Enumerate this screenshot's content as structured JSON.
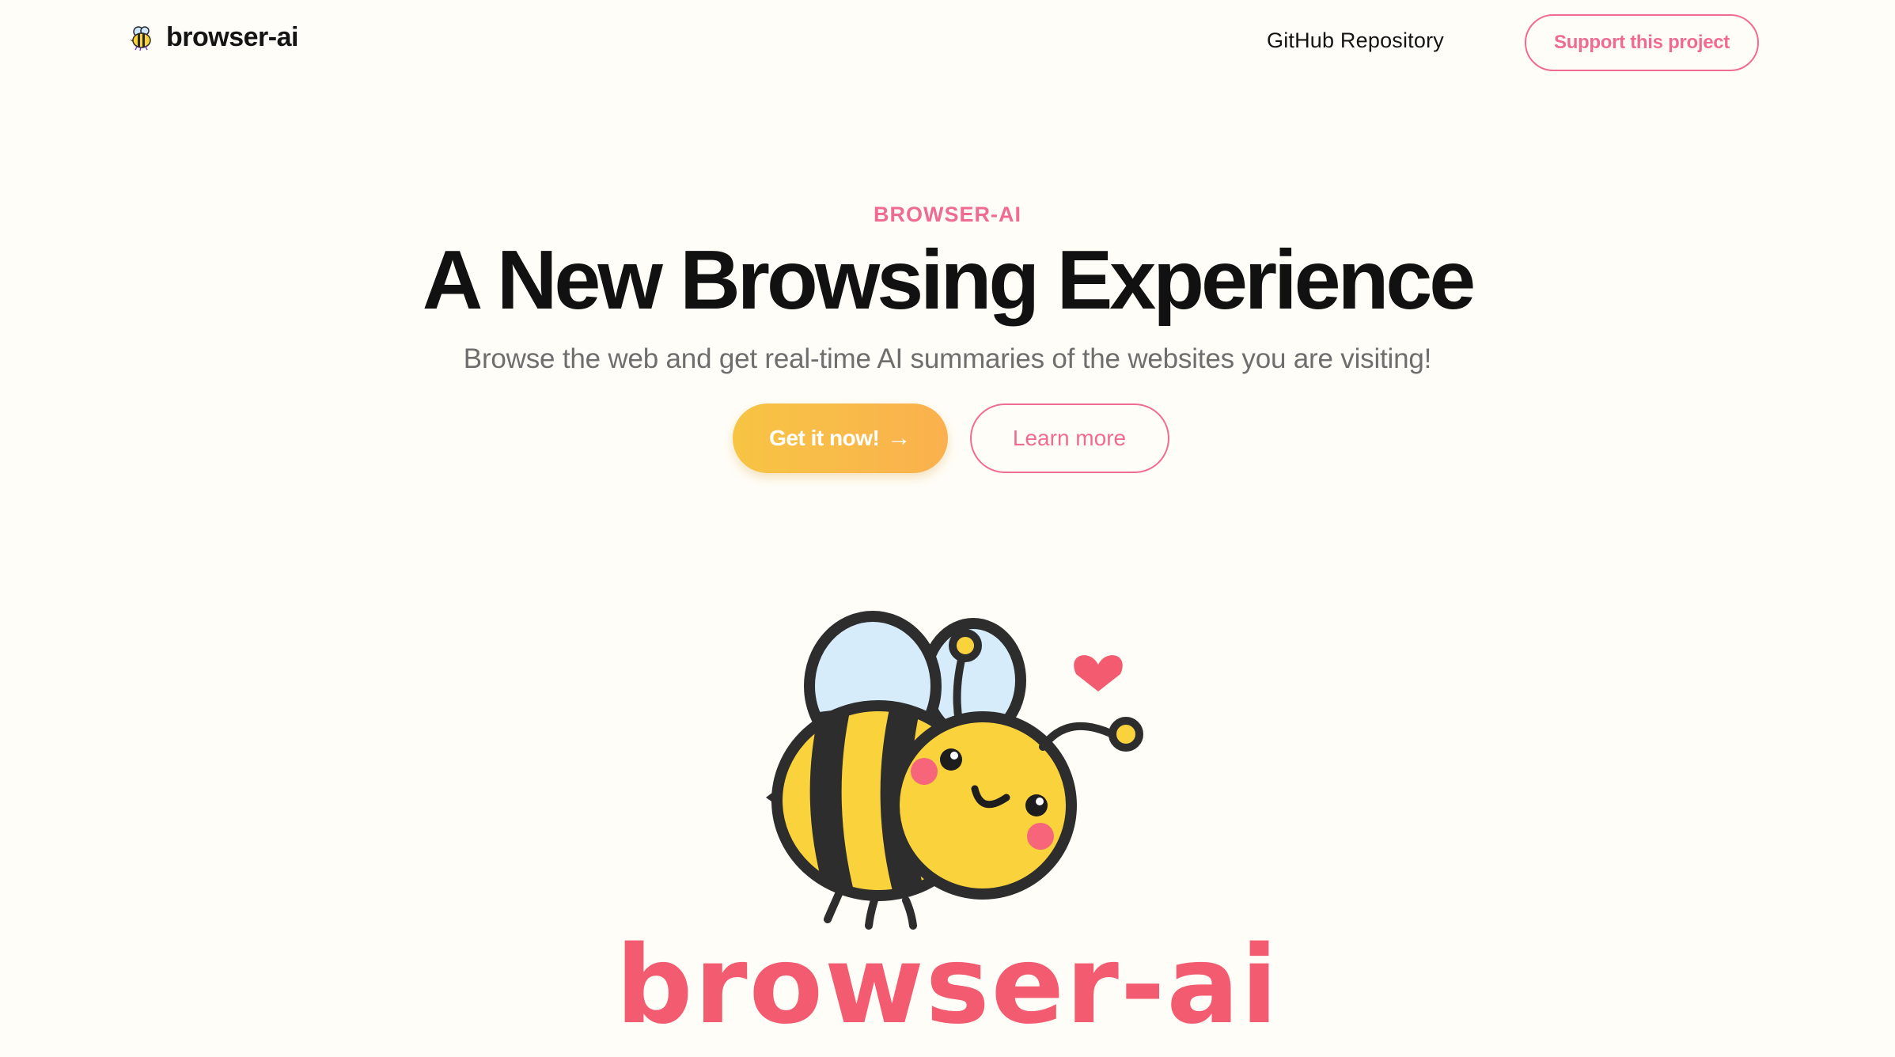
{
  "header": {
    "brand_name": "browser-ai",
    "brand_icon": "bee-icon",
    "nav_github": "GitHub Repository",
    "support_label": "Support this project"
  },
  "hero": {
    "eyebrow": "BROWSER-AI",
    "title": "A New Browsing Experience",
    "subtitle": "Browse the web and get real-time AI summaries of the websites you are visiting!",
    "primary_cta": "Get it now!",
    "primary_cta_icon": "arrow-right-icon",
    "secondary_cta": "Learn more"
  },
  "mascot": {
    "illustration": "bee-mascot",
    "logo_text": "browser-ai"
  },
  "colors": {
    "background": "#fffdf7",
    "accent_pink": "#f06b93",
    "primary_yellow": "#f7c443",
    "logo_red": "#f25b70"
  }
}
